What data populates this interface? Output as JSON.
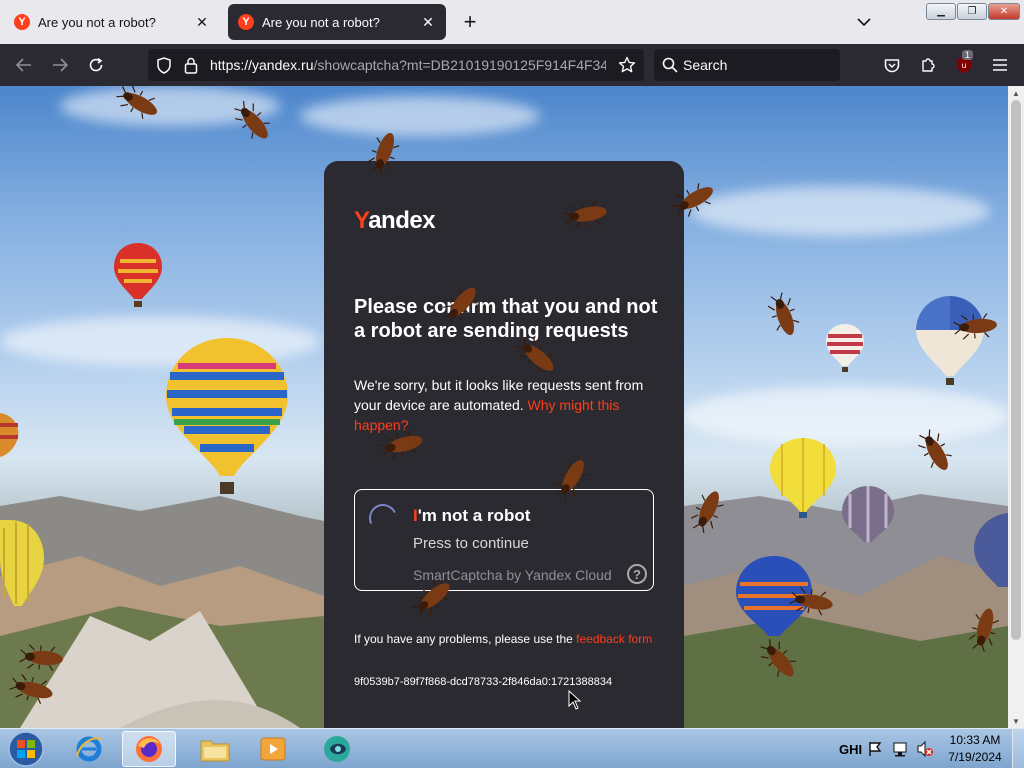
{
  "browser": {
    "tabs": [
      {
        "title": "Are you not a robot?",
        "favicon": "Y",
        "active": false
      },
      {
        "title": "Are you not a robot?",
        "favicon": "Y",
        "active": true
      }
    ],
    "url_host": "https://yandex.ru",
    "url_rest": "/showcaptcha?mt=DB21019190125F914F4F34",
    "search_placeholder": "Search",
    "extension_badge": "1",
    "icons": {
      "back": "arrow-left-icon",
      "forward": "arrow-right-icon",
      "reload": "reload-icon",
      "tracking": "shield-icon",
      "lock": "lock-icon",
      "bookmark": "star-icon",
      "pocket": "pocket-icon",
      "extensions": "puzzle-icon",
      "ublock": "ublock-icon",
      "menu": "hamburger-icon"
    }
  },
  "captcha_page": {
    "logo": {
      "first": "Y",
      "rest": "andex"
    },
    "heading": "Please confirm that you and not a robot are sending requests",
    "description": "We're sorry, but it looks like requests sent from your device are automated.",
    "why_link": "Why might this happen?",
    "checkbox": {
      "title_first": "I",
      "title_rest": "'m not a robot",
      "subtitle": "Press to continue",
      "brand": "SmartCaptcha by Yandex Cloud",
      "help": "?"
    },
    "problems_text": "If you have any problems, please use the",
    "feedback_link": "feedback form",
    "request_id": "9f0539b7-89f7f868-dcd78733-2f846da0:1721388834"
  },
  "taskbar": {
    "apps": [
      "internet-explorer-icon",
      "firefox-icon",
      "file-explorer-icon",
      "media-player-icon",
      "app-icon"
    ],
    "language": "GHI",
    "time": "10:33 AM",
    "date": "7/19/2024"
  },
  "colors": {
    "yandex_red": "#fc3f1d",
    "card_bg": "#2b2a30",
    "browser_dark": "#2b2a33"
  }
}
